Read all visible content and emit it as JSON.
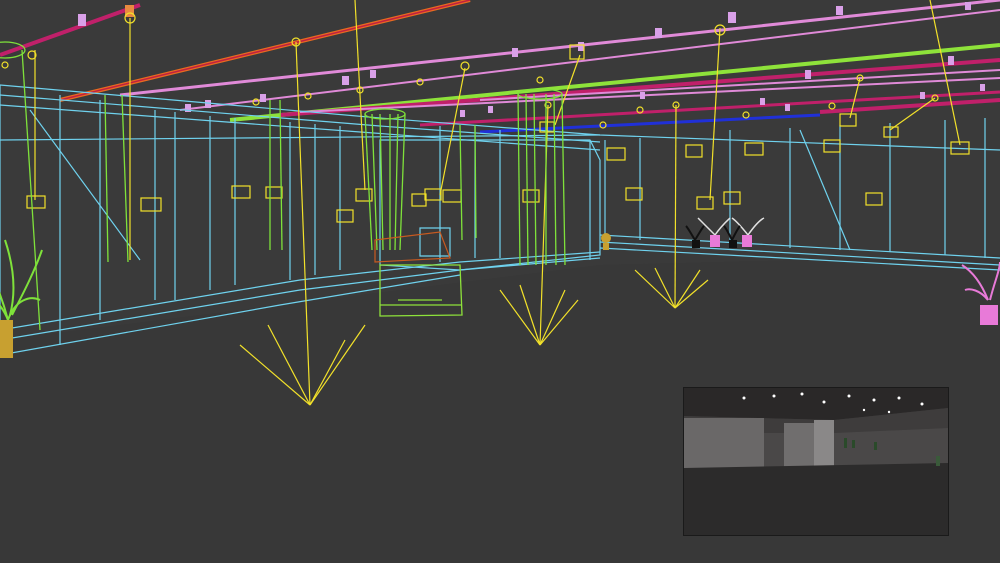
{
  "viewport": {
    "background": "#3a3a3a",
    "grid_visible": false
  },
  "colors": {
    "wall_wire": "#6fd2ee",
    "column_wire": "#7fe23a",
    "light_target": "#f2e12a",
    "track_pink": "#e08ad8",
    "track_green": "#8ee23a",
    "track_magenta": "#c0206a",
    "track_blue": "#2030d8",
    "track_orange": "#e86a20",
    "plant_pink": "#e87ad8",
    "plant_green": "#7fe23a",
    "plant_black": "#111111"
  },
  "icons": {
    "spot_light": "spot-light-icon",
    "frame": "picture-frame-icon",
    "plant": "potted-plant-icon"
  },
  "render_preview": {
    "visible": true
  }
}
